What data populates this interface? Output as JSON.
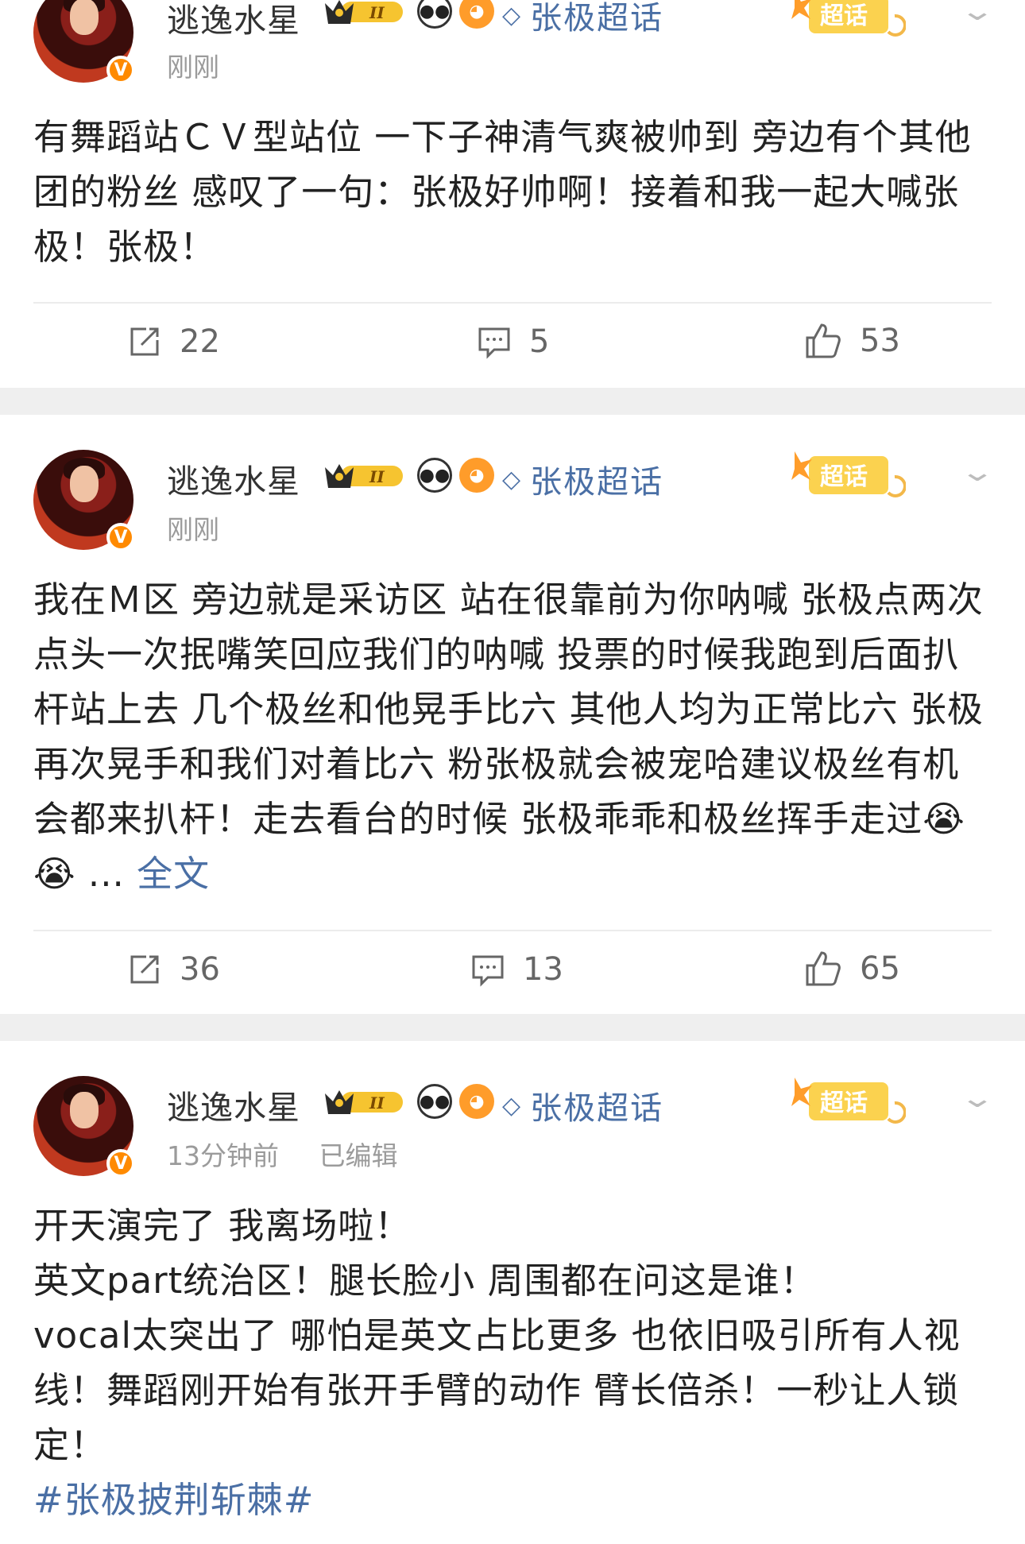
{
  "posts": [
    {
      "username": "逃逸水星",
      "level": "II",
      "topic": "张极超话",
      "chaohua_label": "超话",
      "time": "刚刚",
      "edited": "",
      "content": [
        "有舞蹈站ＣＶ型站位 一下子神清气爽被帅到 旁边有个其他团的粉丝 感叹了一句：张极好帅啊！接着和我一起大喊张极！张极！"
      ],
      "more_label": "",
      "hashtag": "",
      "reposts": "22",
      "comments": "5",
      "likes": "53"
    },
    {
      "username": "逃逸水星",
      "level": "II",
      "topic": "张极超话",
      "chaohua_label": "超话",
      "time": "刚刚",
      "edited": "",
      "content": [
        "我在Ｍ区 旁边就是采访区 站在很靠前为你呐喊 张极点两次点头一次抿嘴笑回应我们的呐喊 投票的时候我跑到后面扒杆站上去 几个极丝和他晃手比六 其他人均为正常比六 张极再次晃手和我们对着比六 粉张极就会被宠哈建议极丝有机会都来扒杆！走去看台的时候 张极乖乖和极丝挥手走过😭😭 ..."
      ],
      "more_label": "全文",
      "hashtag": "",
      "reposts": "36",
      "comments": "13",
      "likes": "65"
    },
    {
      "username": "逃逸水星",
      "level": "II",
      "topic": "张极超话",
      "chaohua_label": "超话",
      "time": "13分钟前",
      "edited": "已编辑",
      "content": [
        "开天演完了 我离场啦！",
        "英文part统治区！腿长脸小 周围都在问这是谁！",
        "vocal太突出了 哪怕是英文占比更多 也依旧吸引所有人视线！舞蹈刚开始有张开手臂的动作 臂长倍杀！一秒让人锁定！"
      ],
      "more_label": "",
      "hashtag": "#张极披荆斩棘#",
      "reposts": "",
      "comments": "",
      "likes": ""
    }
  ],
  "icons": {
    "repost": "repost-icon",
    "comment": "comment-icon",
    "like": "thumbs-up-icon",
    "verified": "verified-v-icon",
    "chevron": "chevron-down-icon",
    "topic": "super-topic-diamond-icon"
  },
  "colors": {
    "link": "#4a6fa5",
    "verified": "#ff8a00",
    "gap": "#efefef"
  }
}
